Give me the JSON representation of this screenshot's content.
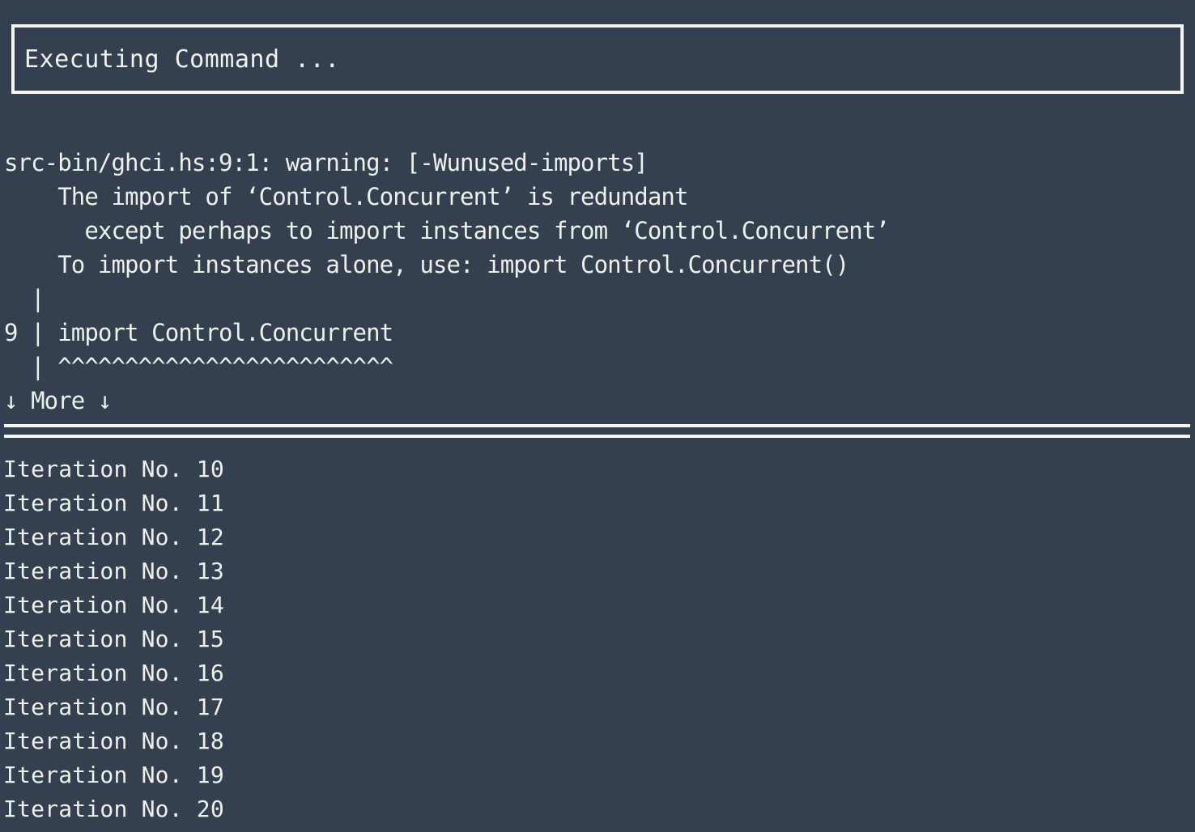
{
  "terminal": {
    "background_color": "#343f50",
    "foreground_color": "#f2f2ec",
    "border_color": "#f5f5ef"
  },
  "status_box": {
    "label": "Executing Command ..."
  },
  "compiler_warning": {
    "lines": [
      "src-bin/ghci.hs:9:1: warning: [-Wunused-imports]",
      "    The import of ‘Control.Concurrent’ is redundant",
      "      except perhaps to import instances from ‘Control.Concurrent’",
      "    To import instances alone, use: import Control.Concurrent()",
      "  |",
      "9 | import Control.Concurrent",
      "  | ^^^^^^^^^^^^^^^^^^^^^^^^^",
      "↓ More ↓"
    ],
    "file": "src-bin/ghci.hs",
    "line_number": "9",
    "column_number": "1",
    "severity": "warning",
    "flag": "[-Wunused-imports]",
    "module": "Control.Concurrent",
    "more_indicator": "↓ More ↓"
  },
  "separator": {
    "style": "double-rule"
  },
  "output_log": {
    "lines": [
      "Iteration No. 10",
      "Iteration No. 11",
      "Iteration No. 12",
      "Iteration No. 13",
      "Iteration No. 14",
      "Iteration No. 15",
      "Iteration No. 16",
      "Iteration No. 17",
      "Iteration No. 18",
      "Iteration No. 19",
      "Iteration No. 20"
    ]
  }
}
